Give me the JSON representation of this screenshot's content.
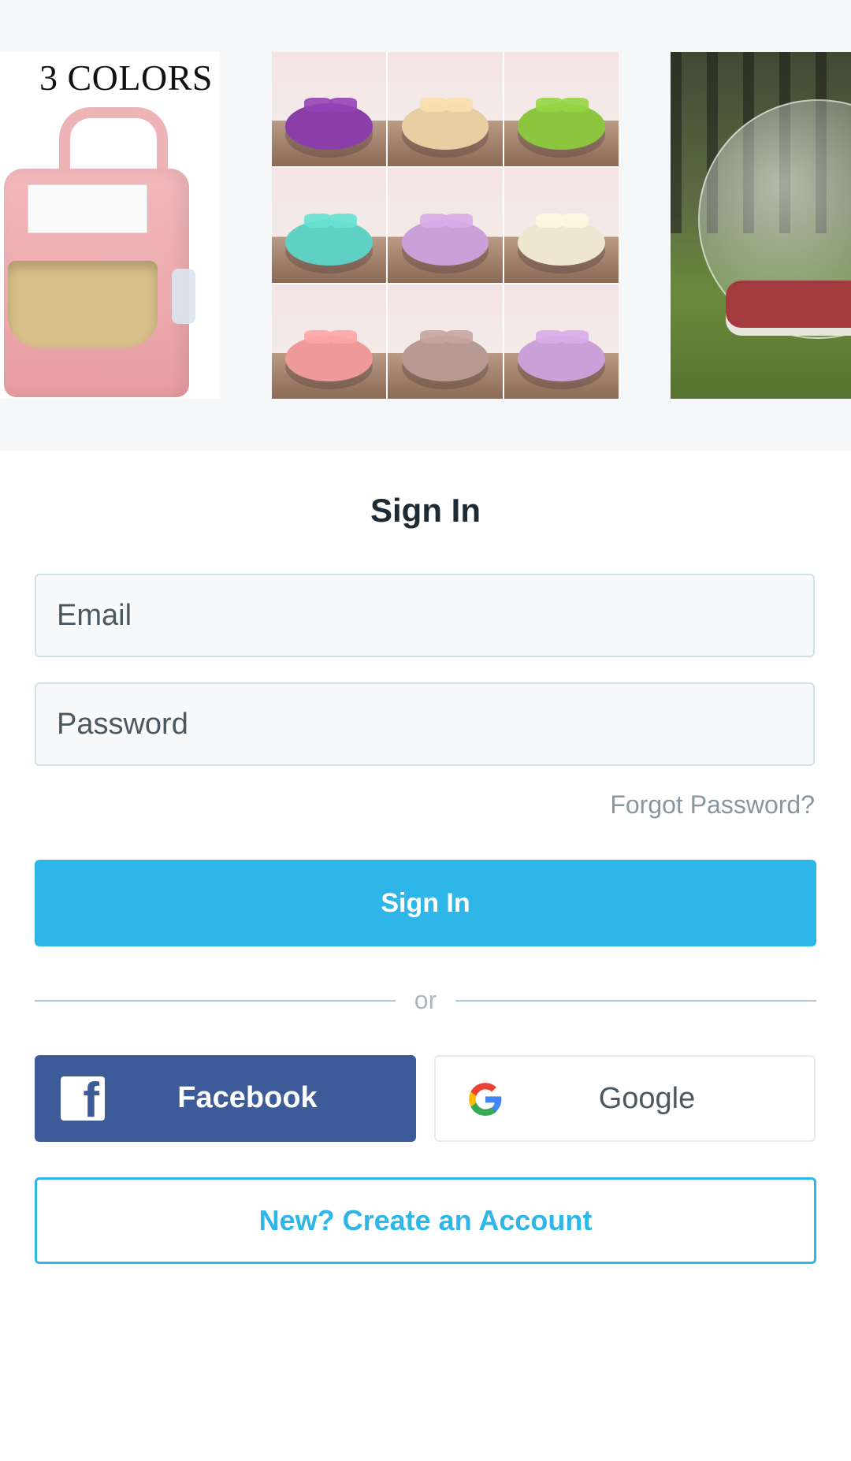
{
  "carousel": {
    "slides": [
      {
        "name": "backpack",
        "caption": "3 COLORS"
      },
      {
        "name": "round-beds",
        "colors": [
          "#8a3fa8",
          "#e6cfa2",
          "#8cc63f",
          "#5fd1c4",
          "#c9a0d8",
          "#efe6cf",
          "#ef9a9a",
          "#b89a94",
          "#c9a0d8"
        ]
      },
      {
        "name": "bubble-tent"
      }
    ]
  },
  "signin": {
    "title": "Sign In",
    "email_placeholder": "Email",
    "password_placeholder": "Password",
    "forgot_label": "Forgot Password?",
    "submit_label": "Sign In",
    "divider_label": "or",
    "facebook_label": "Facebook",
    "google_label": "Google",
    "create_label": "New? Create an Account"
  },
  "colors": {
    "accent": "#2fb6e8",
    "facebook": "#3d5a99",
    "title": "#1d2a33"
  }
}
